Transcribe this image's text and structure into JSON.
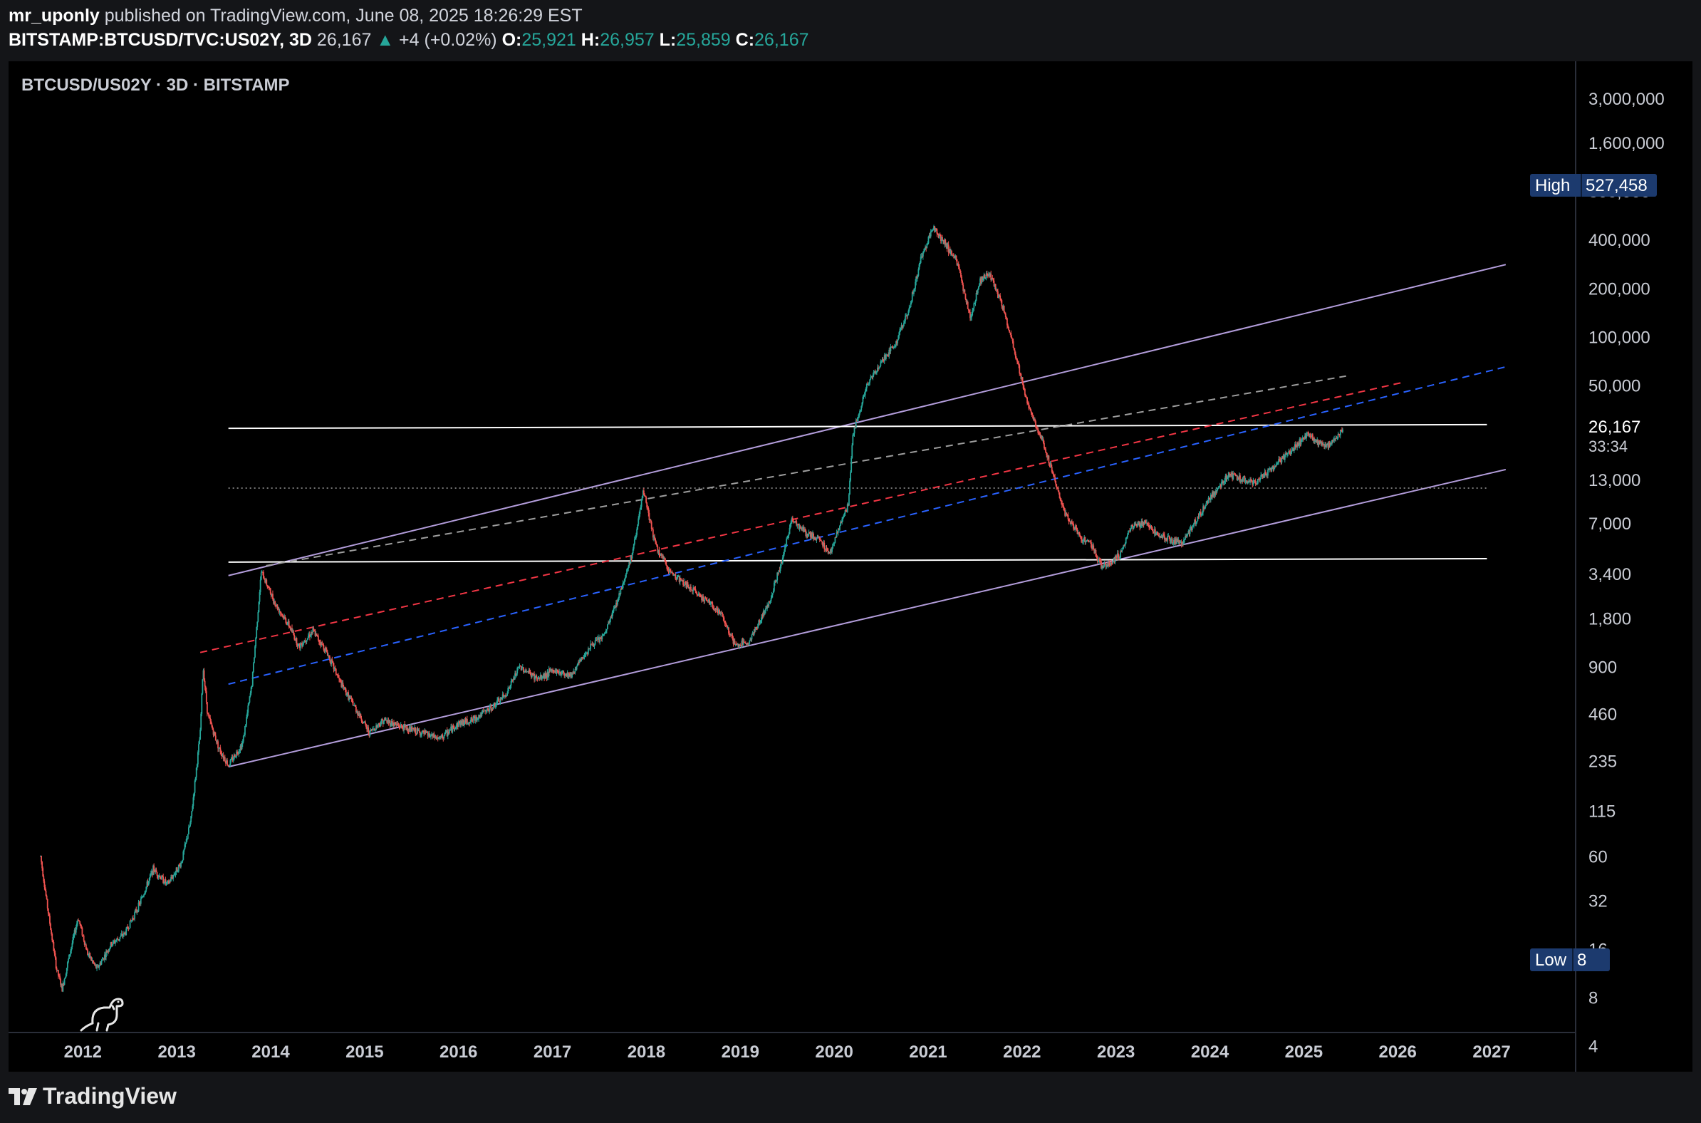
{
  "header": {
    "author": "mr_uponly",
    "published_text": "published on TradingView.com, June 08, 2025 18:26:29 EST",
    "symbol": "BITSTAMP:BTCUSD/TVC:US02Y, 3D",
    "last": "26,167",
    "change": "+4 (+0.02%)",
    "o_label": "O:",
    "o_value": "25,921",
    "h_label": "H:",
    "h_value": "26,957",
    "l_label": "L:",
    "l_value": "25,859",
    "c_label": "C:",
    "c_value": "26,167"
  },
  "legend": {
    "title": "BTCUSD/US02Y · 3D · BITSTAMP"
  },
  "price_scale": {
    "badge_high_label": "High",
    "badge_high_value": "527,458",
    "badge_low_label": "Low",
    "badge_low_value": "8",
    "last_price_label": "26,167",
    "countdown": "33:34"
  },
  "footer": {
    "brand": "TradingView"
  },
  "colors": {
    "background": "#000000",
    "up": "#26a69a",
    "down": "#ef5350",
    "channel": "#b39ddb",
    "horizontal": "#ffffff",
    "dash_red": "#f23645",
    "dash_blue": "#2962ff",
    "dash_gray": "#9e9e9e",
    "badge": "#1c3a6e"
  },
  "chart_data": {
    "type": "candlestick",
    "scale": "log",
    "ylim": [
      3,
      5000000
    ],
    "xlim": [
      2011.3,
      2027.5
    ],
    "x_ticks": [
      "2012",
      "2013",
      "2014",
      "2015",
      "2016",
      "2017",
      "2018",
      "2019",
      "2020",
      "2021",
      "2022",
      "2023",
      "2024",
      "2025",
      "2026",
      "2027"
    ],
    "y_ticks": [
      "3,000,000",
      "1,600,000",
      "800,000",
      "400,000",
      "200,000",
      "100,000",
      "50,000",
      "26,167",
      "13,000",
      "7,000",
      "3,400",
      "1,800",
      "900",
      "460",
      "235",
      "115",
      "60",
      "32",
      "16",
      "8",
      "4"
    ],
    "y_tick_values": [
      3000000,
      1600000,
      800000,
      400000,
      200000,
      100000,
      50000,
      26167,
      13000,
      7000,
      3400,
      1800,
      900,
      460,
      235,
      115,
      60,
      32,
      16,
      8,
      4
    ],
    "price_path": [
      [
        2011.55,
        60
      ],
      [
        2011.62,
        30
      ],
      [
        2011.72,
        12
      ],
      [
        2011.78,
        9
      ],
      [
        2011.85,
        14
      ],
      [
        2011.95,
        25
      ],
      [
        2012.05,
        15
      ],
      [
        2012.15,
        12
      ],
      [
        2012.3,
        17
      ],
      [
        2012.45,
        20
      ],
      [
        2012.6,
        30
      ],
      [
        2012.75,
        50
      ],
      [
        2012.9,
        40
      ],
      [
        2013.05,
        55
      ],
      [
        2013.15,
        100
      ],
      [
        2013.25,
        350
      ],
      [
        2013.28,
        900
      ],
      [
        2013.33,
        450
      ],
      [
        2013.45,
        280
      ],
      [
        2013.55,
        220
      ],
      [
        2013.7,
        300
      ],
      [
        2013.8,
        700
      ],
      [
        2013.9,
        3500
      ],
      [
        2014.05,
        2200
      ],
      [
        2014.2,
        1600
      ],
      [
        2014.3,
        1200
      ],
      [
        2014.45,
        1500
      ],
      [
        2014.6,
        1100
      ],
      [
        2014.75,
        700
      ],
      [
        2014.9,
        500
      ],
      [
        2015.05,
        350
      ],
      [
        2015.2,
        420
      ],
      [
        2015.4,
        380
      ],
      [
        2015.6,
        350
      ],
      [
        2015.8,
        320
      ],
      [
        2016.0,
        400
      ],
      [
        2016.15,
        420
      ],
      [
        2016.35,
        500
      ],
      [
        2016.5,
        600
      ],
      [
        2016.65,
        900
      ],
      [
        2016.85,
        750
      ],
      [
        2017.0,
        850
      ],
      [
        2017.2,
        800
      ],
      [
        2017.4,
        1200
      ],
      [
        2017.55,
        1400
      ],
      [
        2017.7,
        2400
      ],
      [
        2017.85,
        4500
      ],
      [
        2017.97,
        11000
      ],
      [
        2018.1,
        5000
      ],
      [
        2018.25,
        3500
      ],
      [
        2018.45,
        2800
      ],
      [
        2018.65,
        2300
      ],
      [
        2018.8,
        1900
      ],
      [
        2018.95,
        1200
      ],
      [
        2019.1,
        1300
      ],
      [
        2019.3,
        2200
      ],
      [
        2019.45,
        4200
      ],
      [
        2019.55,
        7500
      ],
      [
        2019.7,
        6000
      ],
      [
        2019.85,
        5500
      ],
      [
        2019.95,
        4500
      ],
      [
        2020.05,
        6500
      ],
      [
        2020.15,
        9000
      ],
      [
        2020.2,
        25000
      ],
      [
        2020.35,
        50000
      ],
      [
        2020.5,
        70000
      ],
      [
        2020.65,
        90000
      ],
      [
        2020.8,
        150000
      ],
      [
        2020.92,
        300000
      ],
      [
        2021.05,
        480000
      ],
      [
        2021.15,
        400000
      ],
      [
        2021.3,
        300000
      ],
      [
        2021.45,
        130000
      ],
      [
        2021.55,
        220000
      ],
      [
        2021.65,
        250000
      ],
      [
        2021.8,
        150000
      ],
      [
        2021.95,
        70000
      ],
      [
        2022.05,
        40000
      ],
      [
        2022.15,
        28000
      ],
      [
        2022.25,
        20000
      ],
      [
        2022.35,
        13000
      ],
      [
        2022.45,
        8000
      ],
      [
        2022.6,
        6000
      ],
      [
        2022.75,
        5000
      ],
      [
        2022.85,
        3700
      ],
      [
        2022.95,
        4000
      ],
      [
        2023.05,
        4500
      ],
      [
        2023.15,
        6500
      ],
      [
        2023.3,
        7000
      ],
      [
        2023.45,
        6000
      ],
      [
        2023.6,
        5500
      ],
      [
        2023.7,
        5200
      ],
      [
        2023.8,
        6500
      ],
      [
        2023.95,
        9000
      ],
      [
        2024.1,
        12000
      ],
      [
        2024.2,
        14000
      ],
      [
        2024.35,
        13000
      ],
      [
        2024.5,
        12500
      ],
      [
        2024.65,
        15000
      ],
      [
        2024.8,
        18000
      ],
      [
        2024.95,
        22000
      ],
      [
        2025.05,
        25000
      ],
      [
        2025.15,
        22000
      ],
      [
        2025.25,
        21000
      ],
      [
        2025.35,
        24000
      ],
      [
        2025.42,
        26167
      ]
    ],
    "trendlines": [
      {
        "style": "solid",
        "color": "channel",
        "from": [
          2013.55,
          3300
        ],
        "to": [
          2027.15,
          280000
        ]
      },
      {
        "style": "solid",
        "color": "channel",
        "from": [
          2013.55,
          215
        ],
        "to": [
          2027.15,
          15000
        ]
      },
      {
        "style": "solid",
        "color": "horizontal",
        "from": [
          2013.55,
          27000
        ],
        "to": [
          2026.95,
          28500
        ]
      },
      {
        "style": "solid",
        "color": "horizontal",
        "from": [
          2013.55,
          4000
        ],
        "to": [
          2026.95,
          4200
        ]
      },
      {
        "style": "dotted",
        "color": "dash_gray",
        "from": [
          2013.55,
          11500
        ],
        "to": [
          2026.95,
          11500
        ]
      },
      {
        "style": "dashed",
        "color": "dash_gray",
        "from": [
          2013.95,
          3800
        ],
        "to": [
          2025.45,
          57000
        ]
      },
      {
        "style": "dashed",
        "color": "dash_red",
        "from": [
          2013.25,
          1100
        ],
        "to": [
          2026.05,
          52000
        ]
      },
      {
        "style": "dashed",
        "color": "dash_blue",
        "from": [
          2013.55,
          700
        ],
        "to": [
          2027.15,
          65000
        ]
      }
    ]
  }
}
